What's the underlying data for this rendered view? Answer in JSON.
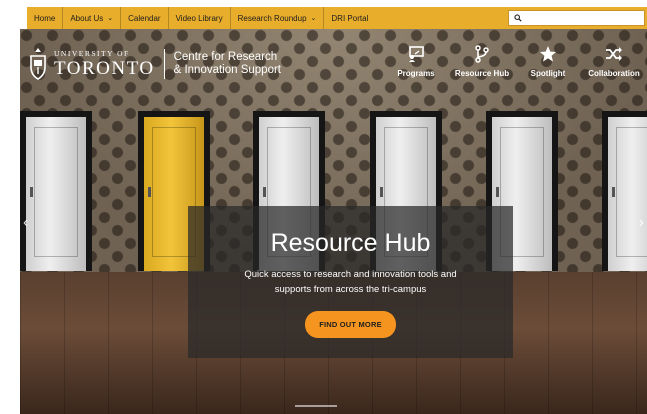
{
  "nav": {
    "items": [
      {
        "label": "Home",
        "has_dropdown": false
      },
      {
        "label": "About Us",
        "has_dropdown": true
      },
      {
        "label": "Calendar",
        "has_dropdown": false
      },
      {
        "label": "Video Library",
        "has_dropdown": false
      },
      {
        "label": "Research Roundup",
        "has_dropdown": true
      },
      {
        "label": "DRI Portal",
        "has_dropdown": false
      }
    ],
    "search_placeholder": "",
    "search_icon": "search-icon",
    "dropdown_icon": "chevron-down-icon"
  },
  "logo": {
    "university_line1": "UNIVERSITY OF",
    "university_line2": "TORONTO",
    "centre_line1": "Centre for Research",
    "centre_line2": "& Innovation Support"
  },
  "quicklinks": [
    {
      "label": "Programs",
      "icon": "presentation-icon"
    },
    {
      "label": "Resource Hub",
      "icon": "branch-icon"
    },
    {
      "label": "Spotlight",
      "icon": "star-icon"
    },
    {
      "label": "Collaboration",
      "icon": "shuffle-icon"
    }
  ],
  "hero": {
    "title": "Resource Hub",
    "description": "Quick access to research and innovation tools and supports from across the tri-campus",
    "cta_label": "FIND OUT MORE",
    "prev_arrow": "chevron-left-icon",
    "next_arrow": "chevron-right-icon"
  },
  "colors": {
    "nav_bar": "#e8ad2b",
    "cta_button": "#f5941f",
    "overlay": "#282828"
  }
}
